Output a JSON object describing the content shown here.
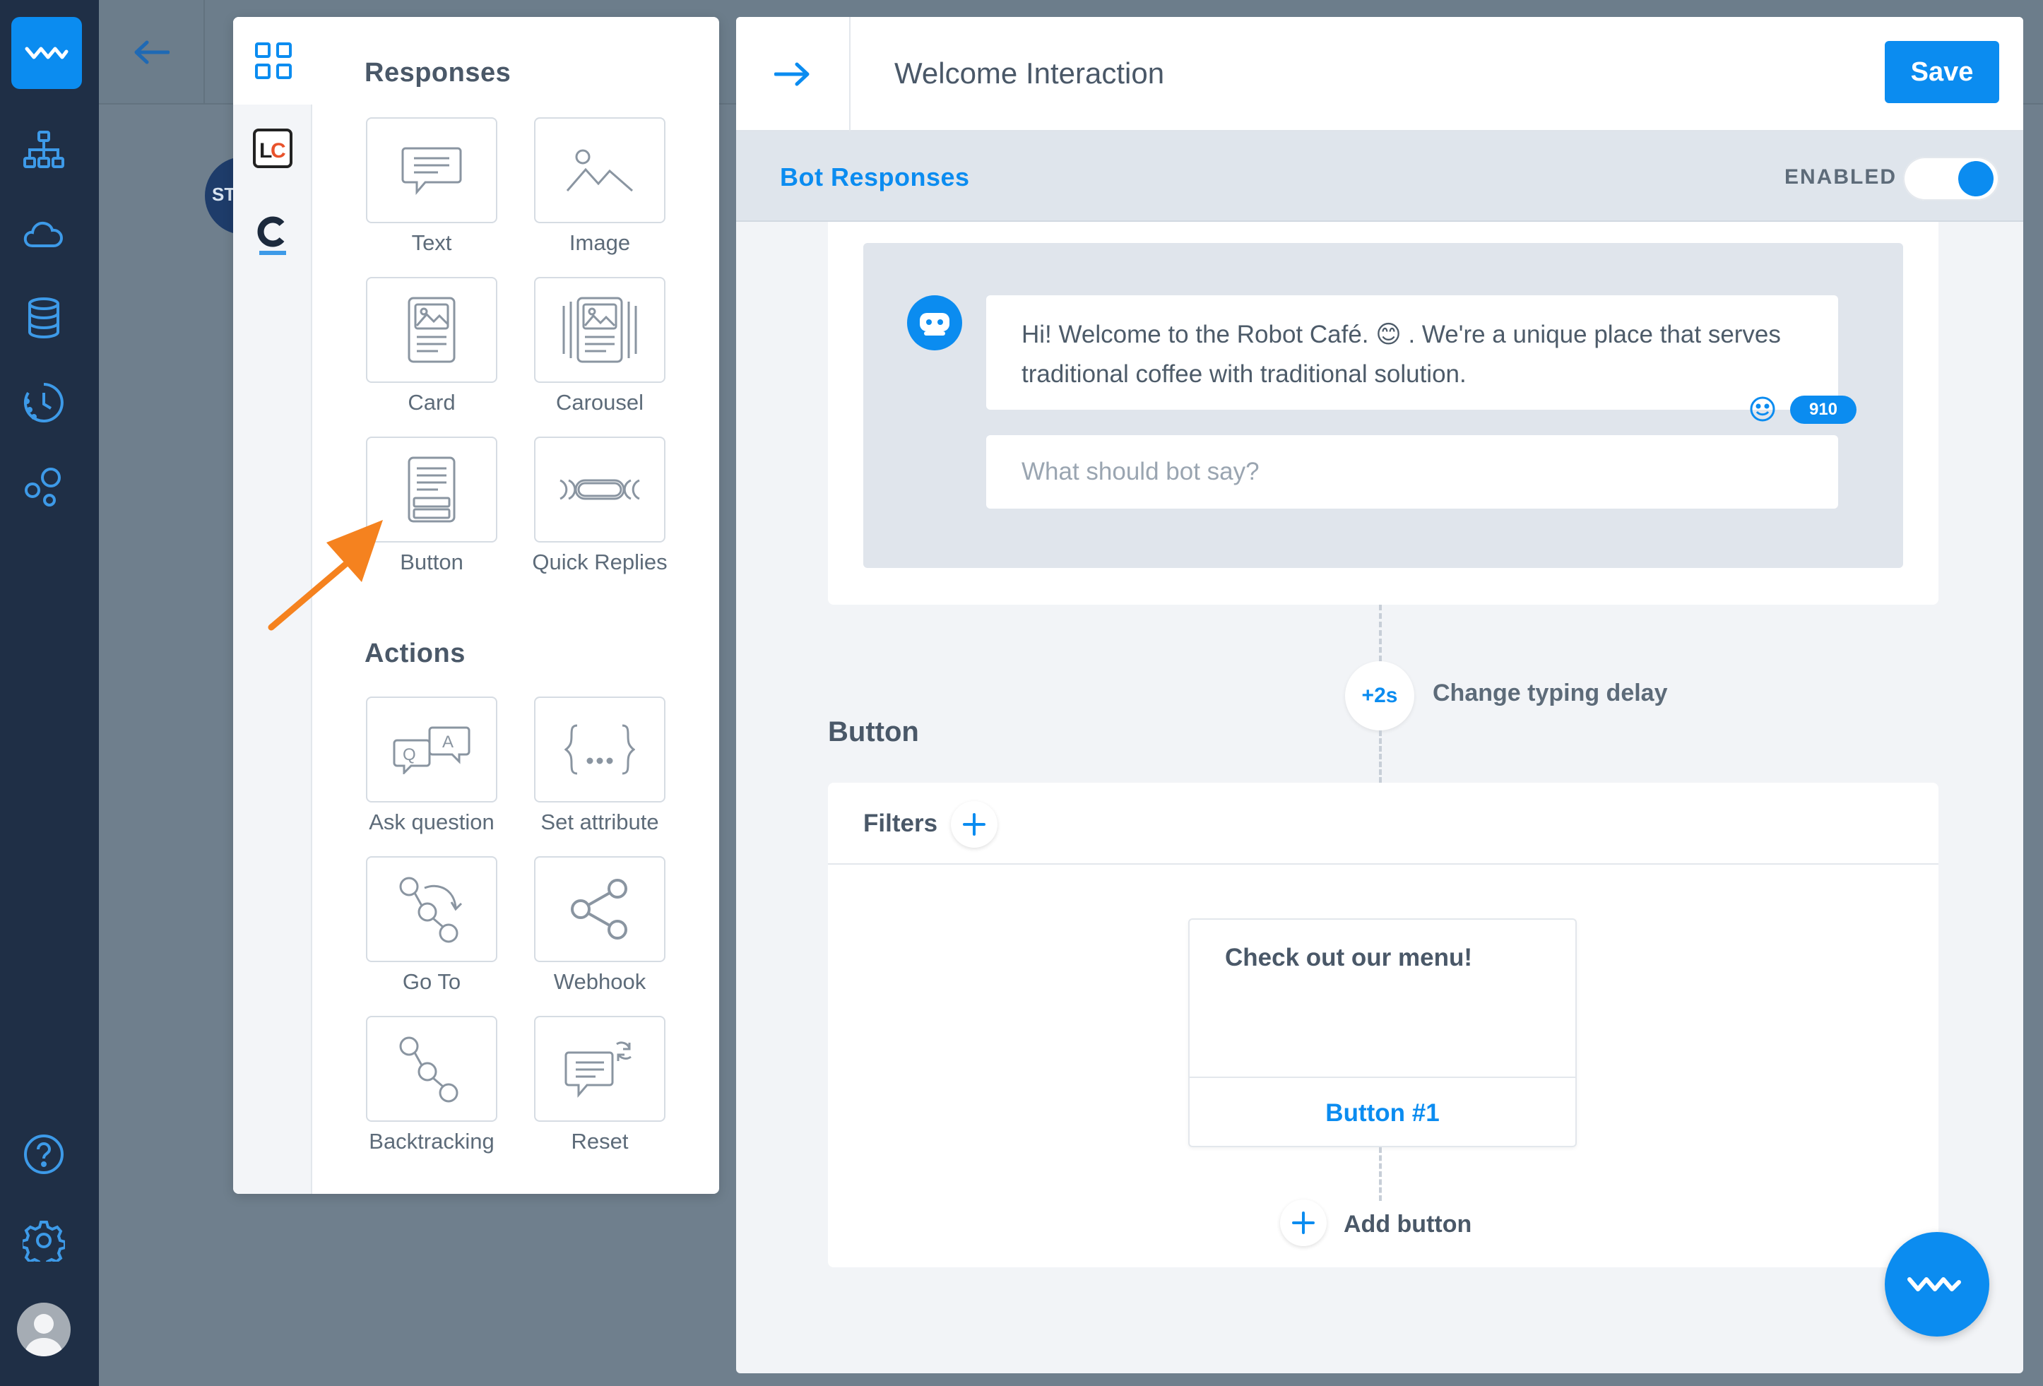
{
  "nav": {
    "icons": [
      "logo-icon",
      "sitemap-icon",
      "cloud-icon",
      "database-icon",
      "clock-icon",
      "bubbles-icon",
      "help-icon",
      "gear-icon",
      "avatar"
    ]
  },
  "background": {
    "circle_label": "ST"
  },
  "picker": {
    "responses_title": "Responses",
    "responses": [
      {
        "label": "Text",
        "icon": "text-icon"
      },
      {
        "label": "Image",
        "icon": "image-icon"
      },
      {
        "label": "Card",
        "icon": "card-icon"
      },
      {
        "label": "Carousel",
        "icon": "carousel-icon"
      },
      {
        "label": "Button",
        "icon": "button-icon"
      },
      {
        "label": "Quick Replies",
        "icon": "quick-replies-icon"
      }
    ],
    "actions_title": "Actions",
    "actions": [
      {
        "label": "Ask question",
        "icon": "qa-icon"
      },
      {
        "label": "Set attribute",
        "icon": "braces-icon"
      },
      {
        "label": "Go To",
        "icon": "goto-icon"
      },
      {
        "label": "Webhook",
        "icon": "webhook-icon"
      },
      {
        "label": "Backtracking",
        "icon": "backtracking-icon"
      },
      {
        "label": "Reset",
        "icon": "reset-icon"
      }
    ],
    "rail_tabs": [
      "grid-icon",
      "lc-icon",
      "c-icon"
    ]
  },
  "editor": {
    "title": "Welcome Interaction",
    "save_label": "Save",
    "section_title": "Bot Responses",
    "enabled_label": "ENABLED",
    "enabled": true,
    "message_text": "Hi! Welcome to the Robot Café. 😊 . We're a unique place that serves traditional coffee with traditional solution.",
    "char_counter": "910",
    "new_message_placeholder": "What should bot say?",
    "typing_delay": "+2s",
    "typing_delay_label": "Change typing delay",
    "block_title": "Button",
    "filters_label": "Filters",
    "button_card_text": "Check out our menu!",
    "button_card_button": "Button #1",
    "add_button_label": "Add button"
  },
  "colors": {
    "accent": "#0b8cf0",
    "nav_bg": "#1f2f46",
    "arrow": "#f5821f"
  }
}
